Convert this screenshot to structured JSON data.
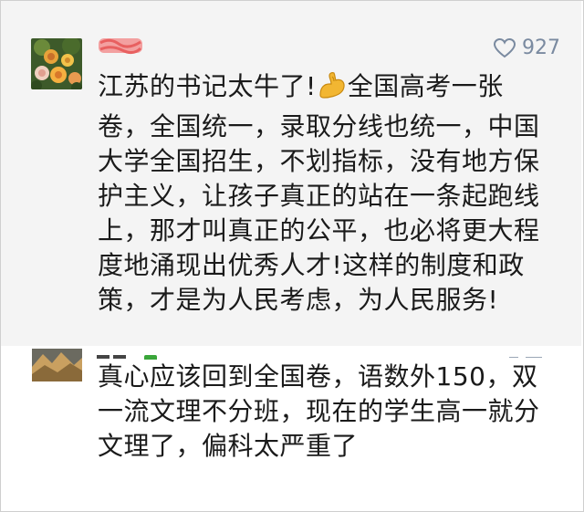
{
  "comments": [
    {
      "likes": "927",
      "text": "江苏的书记太牛了!💪全国高考一张卷，全国统一，录取分线也统一，中国大学全国招生，不划指标，没有地方保护主义，让孩子真正的站在一条起跑线上，那才叫真正的公平，也必将更大程度地涌现出优秀人才!这样的制度和政策，才是为人民考虑，为人民服务!",
      "lines": [
        "江苏的书记太牛了!",
        "全国高考一张",
        "卷，全国统一，录取分线也统一，中国",
        "大学全国招生，不划指标，没有地方保",
        "护主义，让孩子真正的站在一条起跑线",
        "上，那才叫真正的公平，也必将更大程",
        "度地涌现出优秀人才!这样的制度和政",
        "策，才是为人民考虑，为人民服务!"
      ]
    },
    {
      "lines": [
        "真心应该回到全国卷，语数外150，双",
        "一流文理不分班，现在的学生高一就分",
        "文理了，偏科太严重了"
      ]
    }
  ],
  "colors": {
    "highlight_bg": "#f4f4f4",
    "text": "#1a1a1a",
    "likes": "#7a8aa0",
    "redacted_name": "#f08080"
  },
  "icons": {
    "like": "heart-outline-icon",
    "emoji": "flexed-biceps-emoji"
  }
}
